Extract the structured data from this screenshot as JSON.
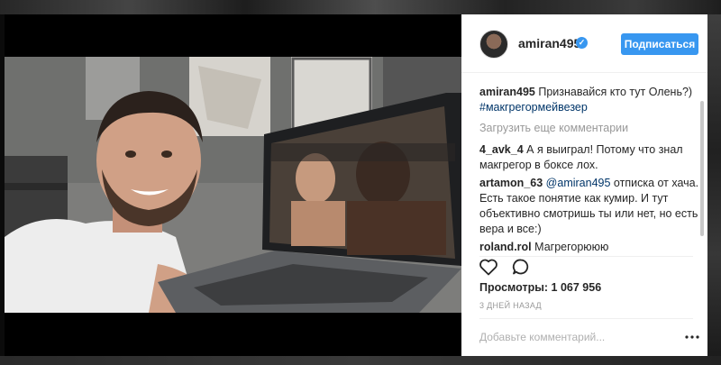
{
  "post": {
    "username": "amiran495",
    "follow_label": "Подписаться",
    "caption_user": "amiran495",
    "caption_text": "Признавайся кто тут Олень?)",
    "caption_hashtag": "#макгрегормейвезер",
    "load_more": "Загрузить еще комментарии",
    "comments": [
      {
        "user": "4_avk_4",
        "text": "А я выиграл! Потому что знал макгрегор в боксе лох."
      },
      {
        "user": "artamon_63",
        "mention": "@amiran495",
        "text": "отписка от хача. Есть такое понятие как кумир. И тут объективно смотришь ты или нет, но есть вера и все:)"
      },
      {
        "user": "roland.rol",
        "text": "Магрегорююю"
      }
    ],
    "views_label": "Просмотры:",
    "views_value": "1 067 956",
    "time_ago": "3 ДНЕЙ НАЗАД",
    "add_comment_placeholder": "Добавьте комментарий...",
    "icons": {
      "like": "heart-icon",
      "comment": "comment-icon",
      "more": "more-dots-icon",
      "verified": "verified-badge-icon"
    }
  },
  "colors": {
    "accent": "#3897f0",
    "link": "#003569",
    "muted": "#999999",
    "text": "#262626"
  }
}
